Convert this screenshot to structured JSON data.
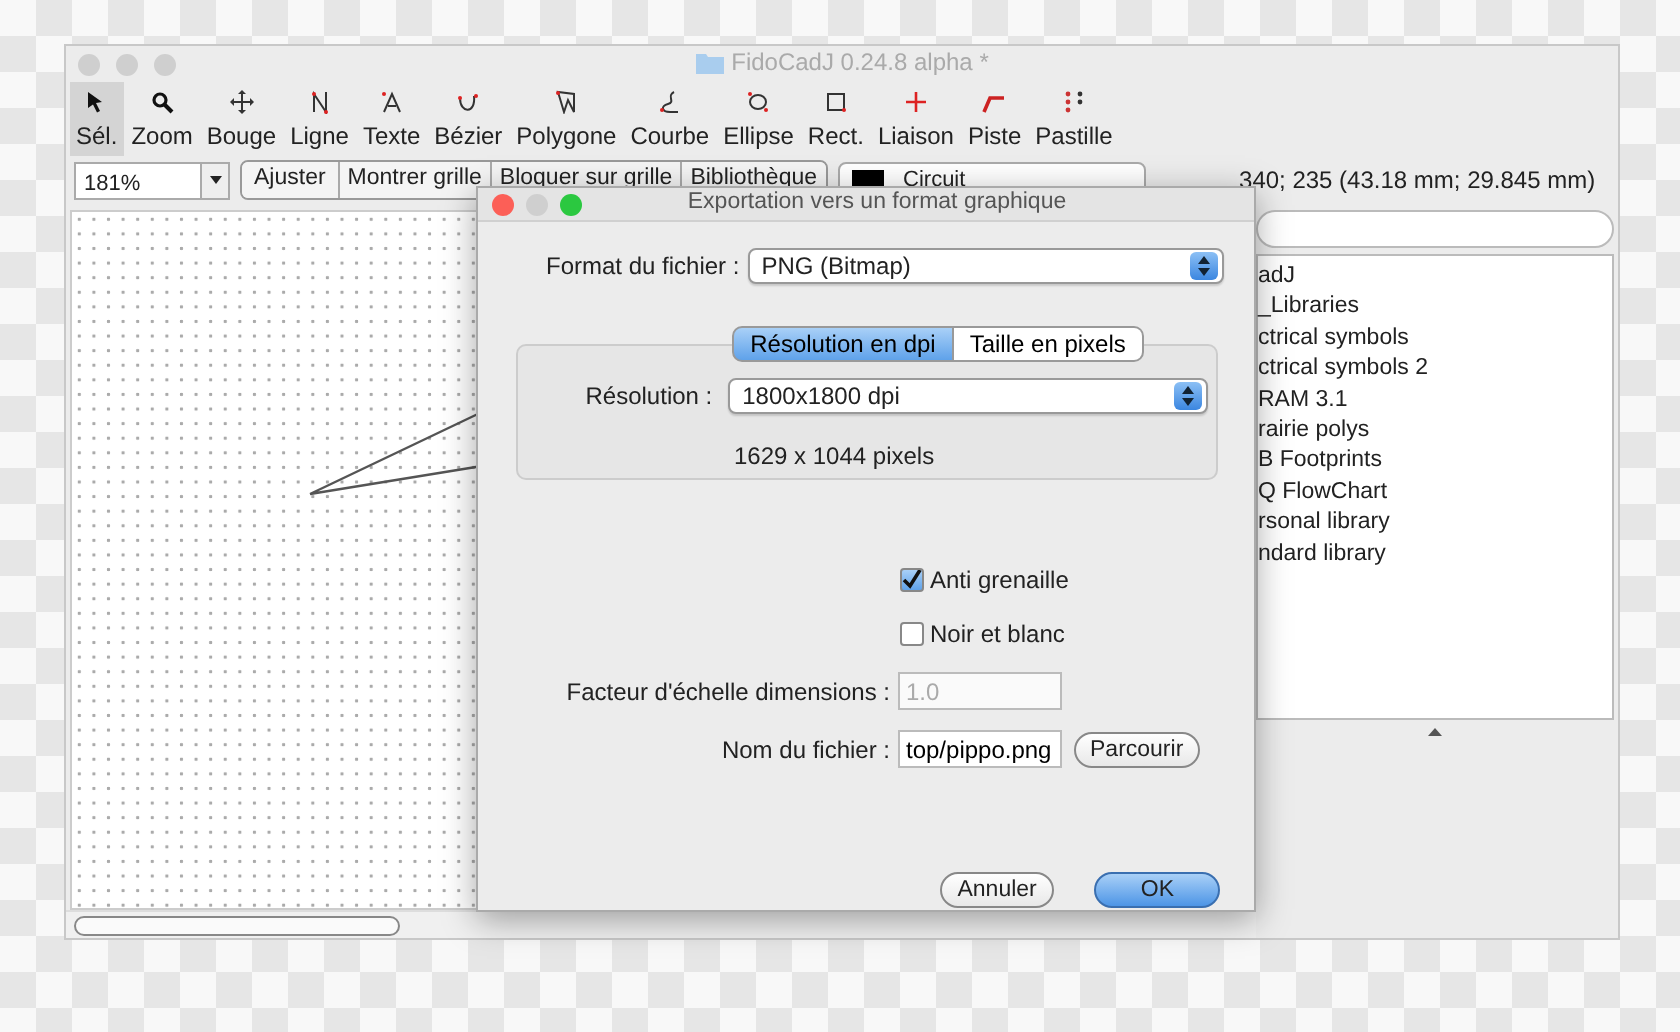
{
  "window": {
    "title": "FidoCadJ 0.24.8 alpha *"
  },
  "tools": [
    {
      "label": "Sél.",
      "selected": true
    },
    {
      "label": "Zoom",
      "selected": false
    },
    {
      "label": "Bouge",
      "selected": false
    },
    {
      "label": "Ligne",
      "selected": false
    },
    {
      "label": "Texte",
      "selected": false
    },
    {
      "label": "Bézier",
      "selected": false
    },
    {
      "label": "Polygone",
      "selected": false
    },
    {
      "label": "Courbe",
      "selected": false
    },
    {
      "label": "Ellipse",
      "selected": false
    },
    {
      "label": "Rect.",
      "selected": false
    },
    {
      "label": "Liaison",
      "selected": false
    },
    {
      "label": "Piste",
      "selected": false
    },
    {
      "label": "Pastille",
      "selected": false
    }
  ],
  "zoom_combo": {
    "value": "181%"
  },
  "view_buttons": [
    "Ajuster",
    "Montrer grille",
    "Bloquer sur grille",
    "Bibliothèque"
  ],
  "layer_combo": {
    "value": "Circuit",
    "color": "#000000"
  },
  "coordinates": "340; 235 (43.18 mm; 29.845 mm)",
  "library": {
    "items": [
      "adJ",
      "_Libraries",
      "ctrical symbols",
      "ctrical symbols 2",
      "RAM 3.1",
      "rairie polys",
      "B Footprints",
      "Q FlowChart",
      "rsonal library",
      "ndard library"
    ]
  },
  "dialog": {
    "title": "Exportation vers un format graphique",
    "format": {
      "label": "Format du fichier :",
      "value": "PNG (Bitmap)"
    },
    "tabs": [
      {
        "label": "Résolution en dpi",
        "selected": true
      },
      {
        "label": "Taille en pixels",
        "selected": false
      }
    ],
    "resolution": {
      "label": "Résolution :",
      "value": "1800x1800 dpi"
    },
    "pixel_size": "1629 x 1044 pixels",
    "options": [
      {
        "label": "Anti grenaille",
        "checked": true
      },
      {
        "label": "Noir et blanc",
        "checked": false
      }
    ],
    "scale": {
      "label": "Facteur d'échelle dimensions :",
      "value": "1.0",
      "disabled": true
    },
    "file": {
      "label": "Nom du fichier :",
      "value": "top/pippo.png",
      "button": "Parcourir"
    },
    "buttons": [
      {
        "label": "Annuler",
        "default": false
      },
      {
        "label": "OK",
        "default": true
      }
    ]
  }
}
